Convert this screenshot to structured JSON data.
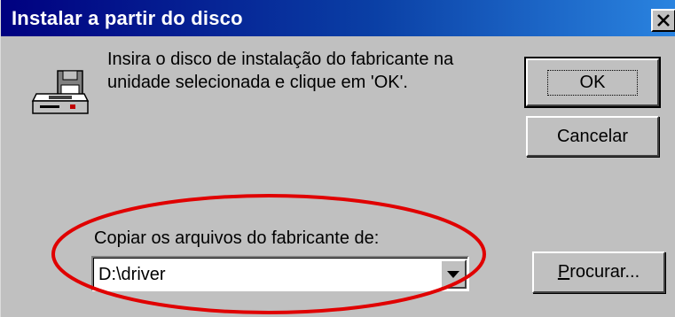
{
  "dialog": {
    "title": "Instalar a partir do disco",
    "message": "Insira o disco de instalação do fabricante na unidade selecionada e clique em 'OK'.",
    "ok_label": "OK",
    "cancel_label": "Cancelar",
    "copy_label": "Copiar os arquivos do fabricante de:",
    "path_value": "D:\\driver",
    "browse_label_underlined": "P",
    "browse_label_rest": "rocurar..."
  },
  "icons": {
    "title_close": "close-icon",
    "disk_drive": "floppy-drive-icon",
    "combo_arrow": "chevron-down-icon"
  },
  "colors": {
    "titlebar_start": "#000080",
    "titlebar_end": "#2a84e0",
    "dialog_face": "#c0c0c0",
    "annotation_ring": "#e00000"
  }
}
